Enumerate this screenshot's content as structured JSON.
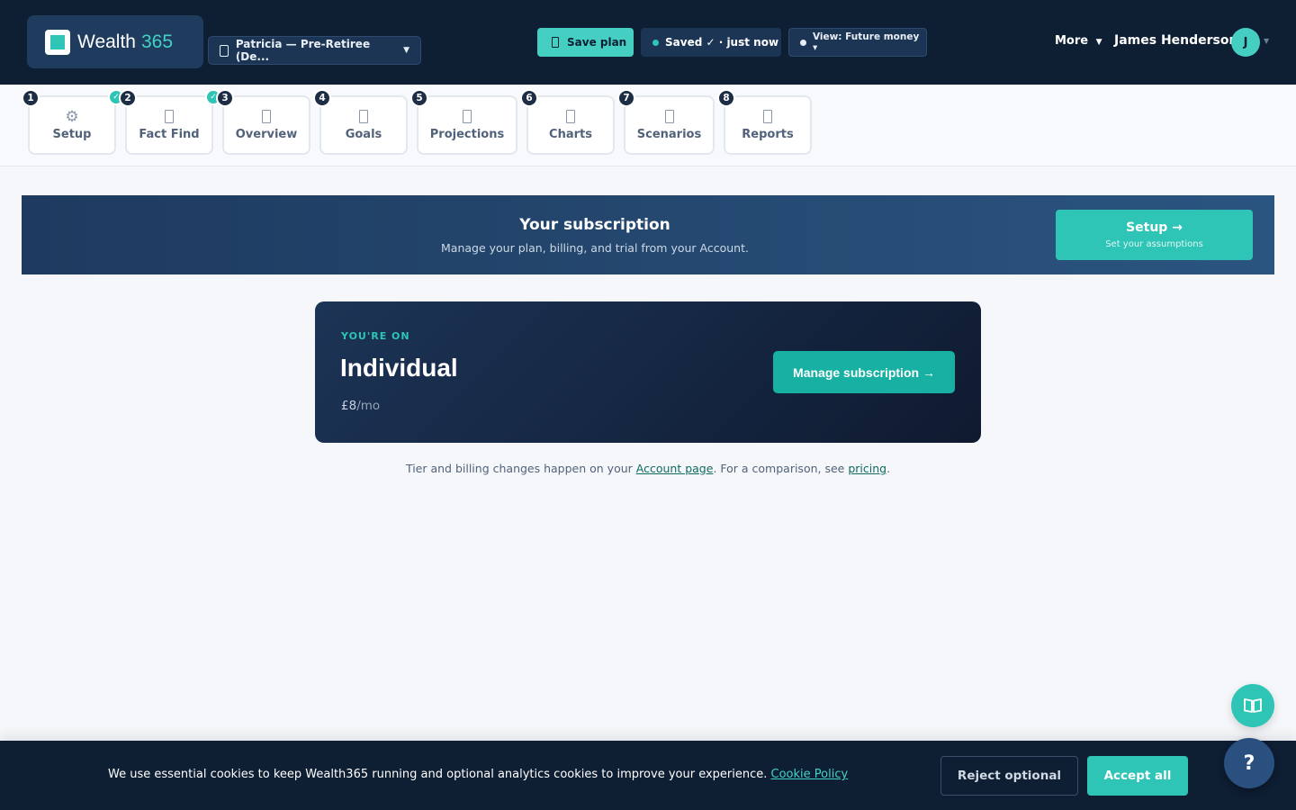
{
  "colors": {
    "brand_dark": "#0e1e33",
    "accent": "#2ec4b6",
    "saved_dot": "#2ec4b6",
    "view_dot": "#e8eef5"
  },
  "header": {
    "brand_word": "Wealth",
    "brand_num": "365",
    "client": "Patricia — Pre-Retiree (De...",
    "save_label": "Save plan",
    "saved_status": "Saved ✓ · just now",
    "view_label": "View: Future money ▾",
    "more_label": "More",
    "user_name": "James Henderson",
    "user_initial": "J"
  },
  "steps": [
    {
      "num": "1",
      "label": "Setup",
      "icon": "gear-icon",
      "done": false
    },
    {
      "num": "2",
      "label": "Fact Find",
      "icon": "document-icon",
      "done": true
    },
    {
      "num": "3",
      "label": "Overview",
      "icon": "document-icon",
      "done": true
    },
    {
      "num": "4",
      "label": "Goals",
      "icon": "document-icon",
      "done": false
    },
    {
      "num": "5",
      "label": "Projections",
      "icon": "document-icon",
      "done": false
    },
    {
      "num": "6",
      "label": "Charts",
      "icon": "document-icon",
      "done": false
    },
    {
      "num": "7",
      "label": "Scenarios",
      "icon": "document-icon",
      "done": false
    },
    {
      "num": "8",
      "label": "Reports",
      "icon": "document-icon",
      "done": false
    }
  ],
  "banner": {
    "title": "Your subscription",
    "subtitle": "Manage your plan, billing, and trial from your Account.",
    "cta_title": "Setup →",
    "cta_sub": "Set your assumptions"
  },
  "plan": {
    "eyebrow": "YOU'RE ON",
    "name": "Individual",
    "price": "£8",
    "per": "/mo",
    "manage_label": "Manage subscription →"
  },
  "note": {
    "before": "Tier and billing changes happen on your ",
    "link1": "Account page",
    "middle": ". For a comparison, see ",
    "link2": "pricing",
    "after": "."
  },
  "help_label": "?",
  "cookie": {
    "text": "We use essential cookies to keep Wealth365 running and optional analytics cookies to improve your experience. ",
    "link": "Cookie Policy",
    "reject": "Reject optional",
    "accept": "Accept all"
  }
}
